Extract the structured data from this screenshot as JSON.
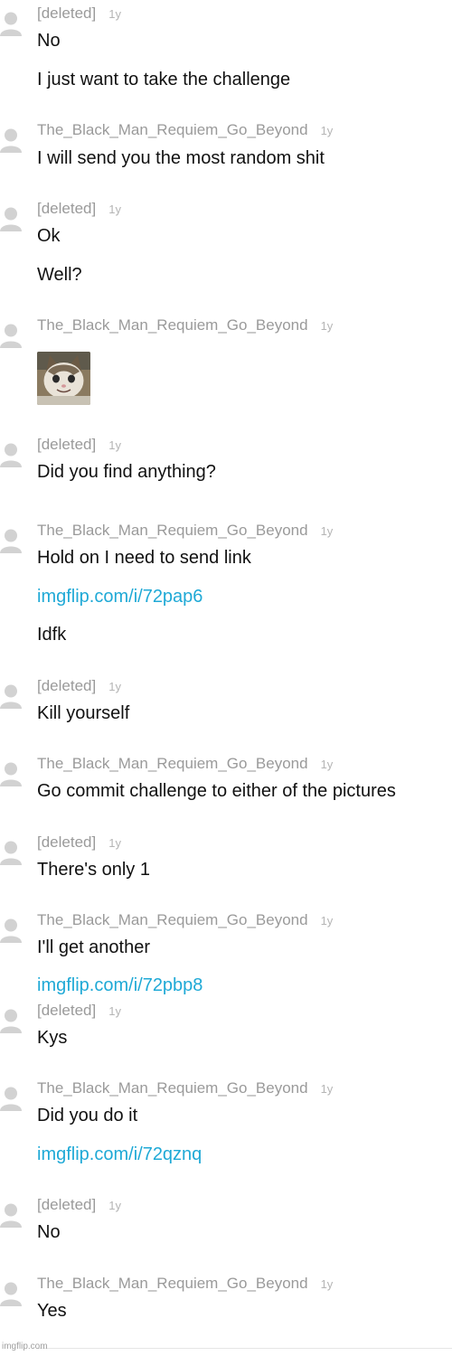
{
  "comments": [
    {
      "author": "[deleted]",
      "time": "1y",
      "lines": [
        "No",
        "I just want to take the challenge"
      ]
    },
    {
      "author": "The_Black_Man_Requiem_Go_Beyond",
      "time": "1y",
      "lines": [
        "I will send you the most random shit"
      ]
    },
    {
      "author": "[deleted]",
      "time": "1y",
      "lines": [
        "Ok",
        "Well?"
      ]
    },
    {
      "author": "The_Black_Man_Requiem_Go_Beyond",
      "time": "1y",
      "image": "cat-face-image"
    },
    {
      "author": "[deleted]",
      "time": "1y",
      "lines": [
        "Did you find anything?"
      ]
    },
    {
      "author": "The_Black_Man_Requiem_Go_Beyond",
      "time": "1y",
      "lines": [
        "Hold on I need to send link",
        "imgflip.com/i/72pap6",
        "Idfk"
      ]
    },
    {
      "author": "[deleted]",
      "time": "1y",
      "lines": [
        "Kill yourself"
      ]
    },
    {
      "author": "The_Black_Man_Requiem_Go_Beyond",
      "time": "1y",
      "lines": [
        "Go commit challenge to either of the pictures"
      ]
    },
    {
      "author": "[deleted]",
      "time": "1y",
      "lines": [
        "There's only 1"
      ]
    },
    {
      "author": "The_Black_Man_Requiem_Go_Beyond",
      "time": "1y",
      "lines": [
        "I'll get another",
        "imgflip.com/i/72pbp8"
      ]
    },
    {
      "author": "[deleted]",
      "time": "1y",
      "lines": [
        "Kys"
      ]
    },
    {
      "author": "The_Black_Man_Requiem_Go_Beyond",
      "time": "1y",
      "lines": [
        "Did you do it",
        "imgflip.com/i/72qznq"
      ]
    },
    {
      "author": "[deleted]",
      "time": "1y",
      "lines": [
        "No"
      ]
    },
    {
      "author": "The_Black_Man_Requiem_Go_Beyond",
      "time": "1y",
      "lines": [
        "Yes"
      ]
    }
  ],
  "watermark": "imgflip.com",
  "colors": {
    "author": "#9a9a9a",
    "time": "#b5b5b5",
    "text": "#111111",
    "link": "#1fa9d6"
  }
}
